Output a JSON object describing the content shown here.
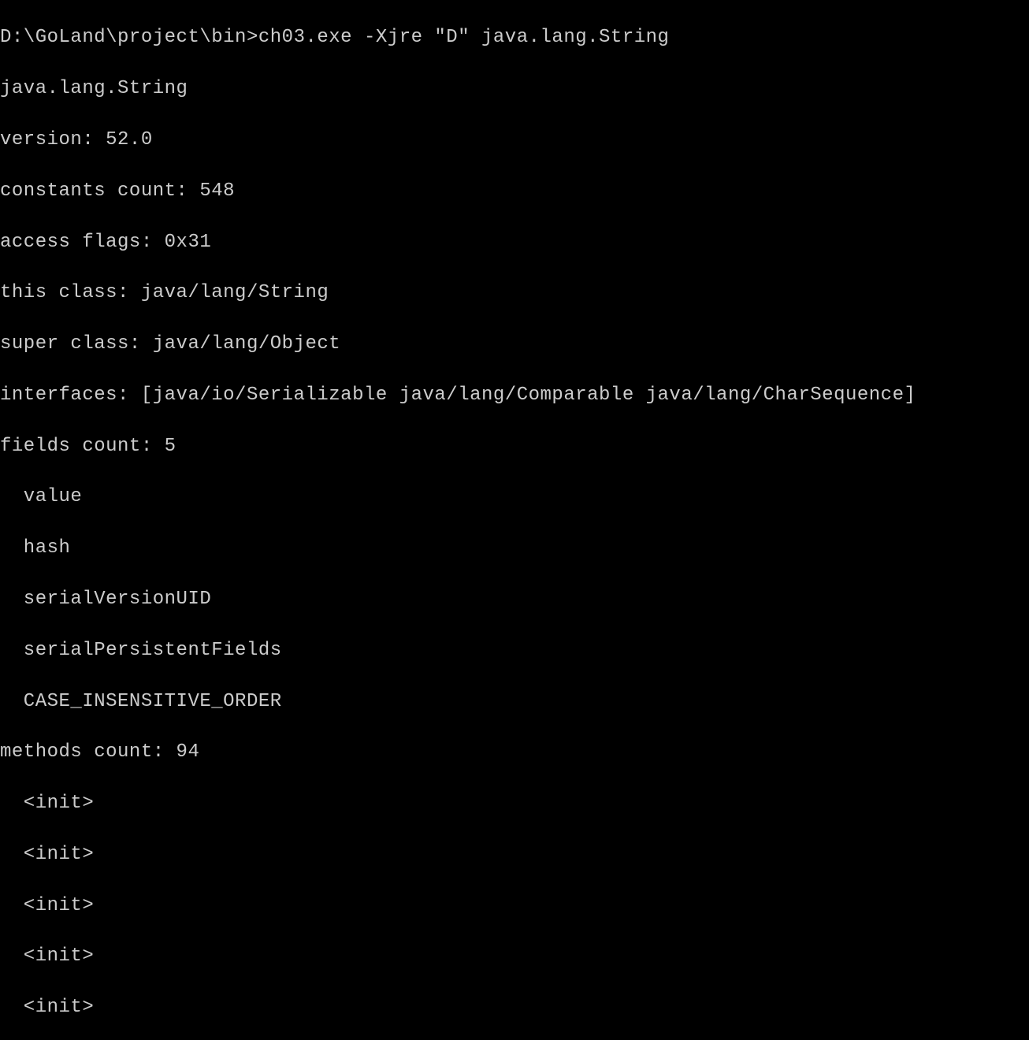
{
  "prompt": "D:\\GoLand\\project\\bin>",
  "command": "ch03.exe -Xjre \"D\" java.lang.String",
  "output": {
    "class_name": "java.lang.String",
    "version_label": "version: ",
    "version_value": "52.0",
    "constants_label": "constants count: ",
    "constants_value": "548",
    "access_flags_label": "access flags: ",
    "access_flags_value": "0x31",
    "this_class_label": "this class: ",
    "this_class_value": "java/lang/String",
    "super_class_label": "super class: ",
    "super_class_value": "java/lang/Object",
    "interfaces_label": "interfaces: ",
    "interfaces_value": "[java/io/Serializable java/lang/Comparable java/lang/CharSequence]",
    "fields_count_label": "fields count: ",
    "fields_count_value": "5",
    "fields": {
      "f0": "  value",
      "f1": "  hash",
      "f2": "  serialVersionUID",
      "f3": "  serialPersistentFields",
      "f4": "  CASE_INSENSITIVE_ORDER"
    },
    "methods_count_label": "methods count: ",
    "methods_count_value": "94",
    "methods": {
      "m0": "  <init>",
      "m1": "  <init>",
      "m2": "  <init>",
      "m3": "  <init>",
      "m4": "  <init>"
    }
  }
}
